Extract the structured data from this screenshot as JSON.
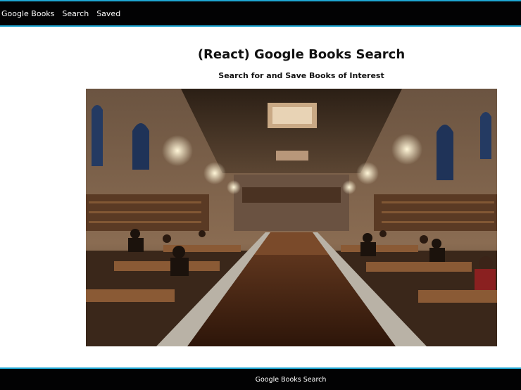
{
  "nav": {
    "brand": "Google Books",
    "search": "Search",
    "saved": "Saved"
  },
  "header": {
    "title": "(React) Google Books Search",
    "subtitle": "Search for and Save Books of Interest"
  },
  "hero": {
    "alt": "Library reading room"
  },
  "footer": {
    "text": "Google Books Search"
  },
  "colors": {
    "nav_bg": "#020203",
    "accent_border": "#1ea5d2"
  }
}
